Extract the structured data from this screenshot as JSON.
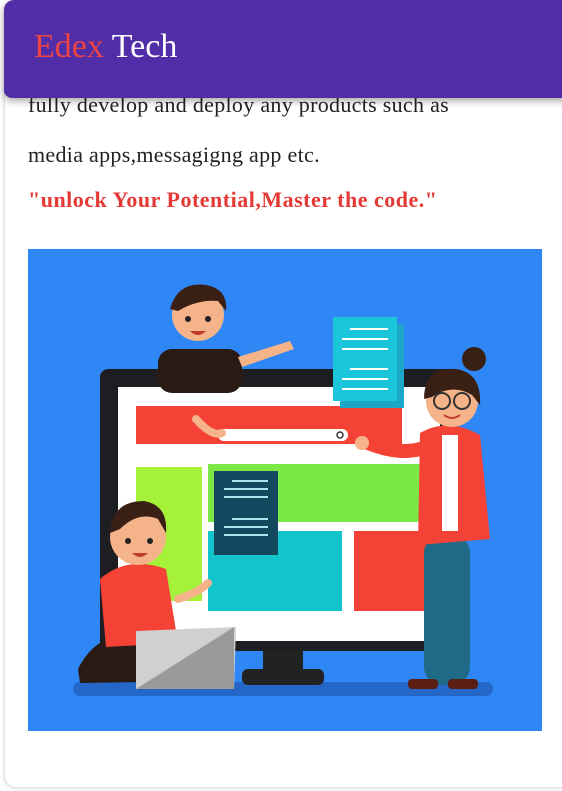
{
  "header": {
    "brand_part1": "Edex",
    "brand_part2": "Tech"
  },
  "content": {
    "line1": "fully develop and deploy any products such as",
    "line2": "media apps,messagigng app etc.",
    "tagline": "\"unlock Your Potential,Master the code.\""
  },
  "colors": {
    "header_bg": "#512da8",
    "brand_accent": "#ef4444",
    "tagline": "#e53935",
    "illustration_bg": "#2f86f5"
  },
  "illustration": {
    "icon": "web-development-team-illustration"
  }
}
